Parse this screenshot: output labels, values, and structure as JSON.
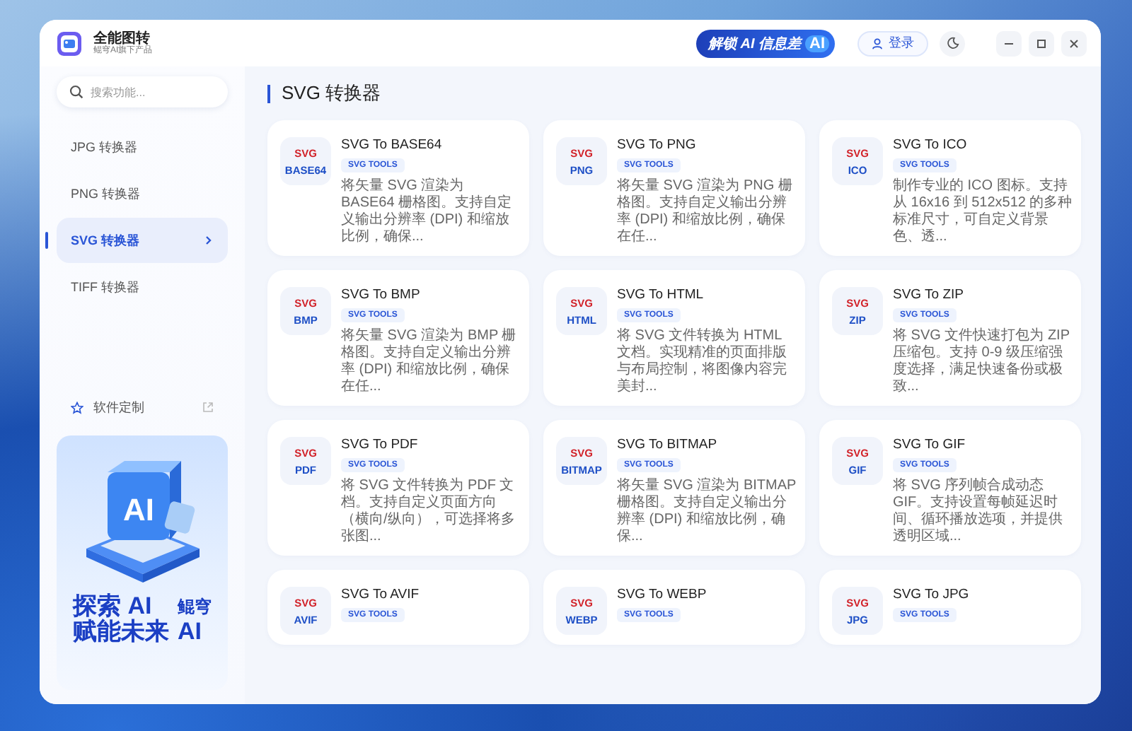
{
  "app": {
    "name": "全能图转",
    "subtitle": "鲲穹AI旗下产品"
  },
  "header": {
    "promo": {
      "title": "解锁 AI 信息差",
      "badge": "AI"
    },
    "login": "登录"
  },
  "sidebar": {
    "search": {
      "placeholder": "搜索功能..."
    },
    "items": [
      {
        "label": "JPG 转换器",
        "selected": false
      },
      {
        "label": "PNG 转换器",
        "selected": false
      },
      {
        "label": "SVG 转换器",
        "selected": true
      },
      {
        "label": "TIFF 转换器",
        "selected": false
      }
    ],
    "custom": {
      "label": "软件定制"
    },
    "banner": {
      "art_label": "AI",
      "line1": "探索 AI",
      "line2": "赋能未来",
      "brand": "鲲穹",
      "brand_ai": "AI"
    }
  },
  "page": {
    "title": "SVG 转换器"
  },
  "tools": [
    {
      "from": "SVG",
      "to": "BASE64",
      "title": "SVG To BASE64",
      "tag": "SVG TOOLS",
      "description": "将矢量 SVG 渲染为 BASE64 栅格图。支持自定义输出分辨率 (DPI) 和缩放比例，确保..."
    },
    {
      "from": "SVG",
      "to": "PNG",
      "title": "SVG To PNG",
      "tag": "SVG TOOLS",
      "description": "将矢量 SVG 渲染为 PNG 栅格图。支持自定义输出分辨率 (DPI) 和缩放比例，确保在任..."
    },
    {
      "from": "SVG",
      "to": "ICO",
      "title": "SVG To ICO",
      "tag": "SVG TOOLS",
      "description": "制作专业的 ICO 图标。支持从 16x16 到 512x512 的多种标准尺寸，可自定义背景色、透..."
    },
    {
      "from": "SVG",
      "to": "BMP",
      "title": "SVG To BMP",
      "tag": "SVG TOOLS",
      "description": "将矢量 SVG 渲染为 BMP 栅格图。支持自定义输出分辨率 (DPI) 和缩放比例，确保在任..."
    },
    {
      "from": "SVG",
      "to": "HTML",
      "title": "SVG To HTML",
      "tag": "SVG TOOLS",
      "description": "将 SVG 文件转换为 HTML 文档。实现精准的页面排版与布局控制，将图像内容完美封..."
    },
    {
      "from": "SVG",
      "to": "ZIP",
      "title": "SVG To ZIP",
      "tag": "SVG TOOLS",
      "description": "将 SVG 文件快速打包为 ZIP 压缩包。支持 0-9 级压缩强度选择，满足快速备份或极致..."
    },
    {
      "from": "SVG",
      "to": "PDF",
      "title": "SVG To PDF",
      "tag": "SVG TOOLS",
      "description": "将 SVG 文件转换为 PDF 文档。支持自定义页面方向（横向/纵向），可选择将多张图..."
    },
    {
      "from": "SVG",
      "to": "BITMAP",
      "title": "SVG To BITMAP",
      "tag": "SVG TOOLS",
      "description": "将矢量 SVG 渲染为 BITMAP 栅格图。支持自定义输出分辨率 (DPI) 和缩放比例，确保..."
    },
    {
      "from": "SVG",
      "to": "GIF",
      "title": "SVG To GIF",
      "tag": "SVG TOOLS",
      "description": "将 SVG 序列帧合成动态 GIF。支持设置每帧延迟时间、循环播放选项，并提供透明区域..."
    },
    {
      "from": "SVG",
      "to": "AVIF",
      "title": "SVG To AVIF",
      "tag": "SVG TOOLS"
    },
    {
      "from": "SVG",
      "to": "WEBP",
      "title": "SVG To WEBP",
      "tag": "SVG TOOLS"
    },
    {
      "from": "SVG",
      "to": "JPG",
      "title": "SVG To JPG",
      "tag": "SVG TOOLS"
    }
  ]
}
